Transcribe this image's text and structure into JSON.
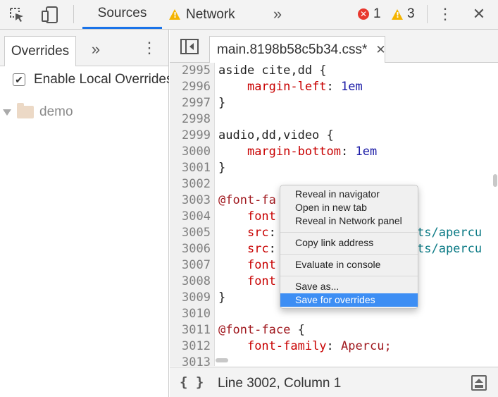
{
  "toolbar": {
    "tabs": [
      {
        "label": "Sources"
      },
      {
        "label": "Network"
      }
    ],
    "more_tabs": "»",
    "error_count": "1",
    "warning_count": "3",
    "error_icon_glyph": "✕",
    "close_glyph": "✕",
    "kebab_glyph": "⋮"
  },
  "left_panel": {
    "tab": "Overrides",
    "more": "»",
    "kebab": "⋮",
    "enable_label": "Enable Local Overrides",
    "checkbox_mark": "✔",
    "checked": true,
    "tree": [
      {
        "name": "demo"
      }
    ]
  },
  "editor": {
    "file_tab": "main.8198b58c5b34.css*",
    "close": "✕",
    "lines": [
      {
        "n": "2995"
      },
      {
        "n": "2996"
      },
      {
        "n": "2997"
      },
      {
        "n": "2998"
      },
      {
        "n": "2999"
      },
      {
        "n": "3000"
      },
      {
        "n": "3001"
      },
      {
        "n": "3002"
      },
      {
        "n": "3003"
      },
      {
        "n": "3004"
      },
      {
        "n": "3005"
      },
      {
        "n": "3006"
      },
      {
        "n": "3007"
      },
      {
        "n": "3008"
      },
      {
        "n": "3009"
      },
      {
        "n": "3010"
      },
      {
        "n": "3011"
      },
      {
        "n": "3012"
      },
      {
        "n": "3013"
      }
    ],
    "code": {
      "l2995": "aside cite,dd {",
      "l2996_prop": "margin-left",
      "l2996_val": "1em",
      "l2997": "}",
      "l2999": "audio,dd,video {",
      "l3000_prop": "margin-bottom",
      "l3000_val": "1em",
      "l3001": "}",
      "l3003": "@font-fa",
      "l3004": "font",
      "l3005_prop": "src",
      "l3005_url": "ts/apercu",
      "l3006_prop": "src",
      "l3006_url": "ts/apercu",
      "l3007": "font",
      "l3008": "font",
      "l3009": "}",
      "l3011": "@font-face",
      "l3011_brace": "{",
      "l3012_prop": "font-family",
      "l3012_val": "Apercu;"
    },
    "colon": ":",
    "status": "Line 3002, Column 1",
    "braces": "{ }"
  },
  "context_menu": {
    "items": [
      {
        "label": "Reveal in navigator"
      },
      {
        "label": "Open in new tab"
      },
      {
        "label": "Reveal in Network panel"
      },
      {
        "label": "Copy link address"
      },
      {
        "label": "Evaluate in console"
      },
      {
        "label": "Save as..."
      },
      {
        "label": "Save for overrides"
      }
    ],
    "highlighted": "Save for overrides"
  },
  "colors": {
    "accent": "#1a73e8",
    "menu_highlight": "#3d8ef4",
    "error": "#e8382e",
    "warning": "#f4b400"
  }
}
